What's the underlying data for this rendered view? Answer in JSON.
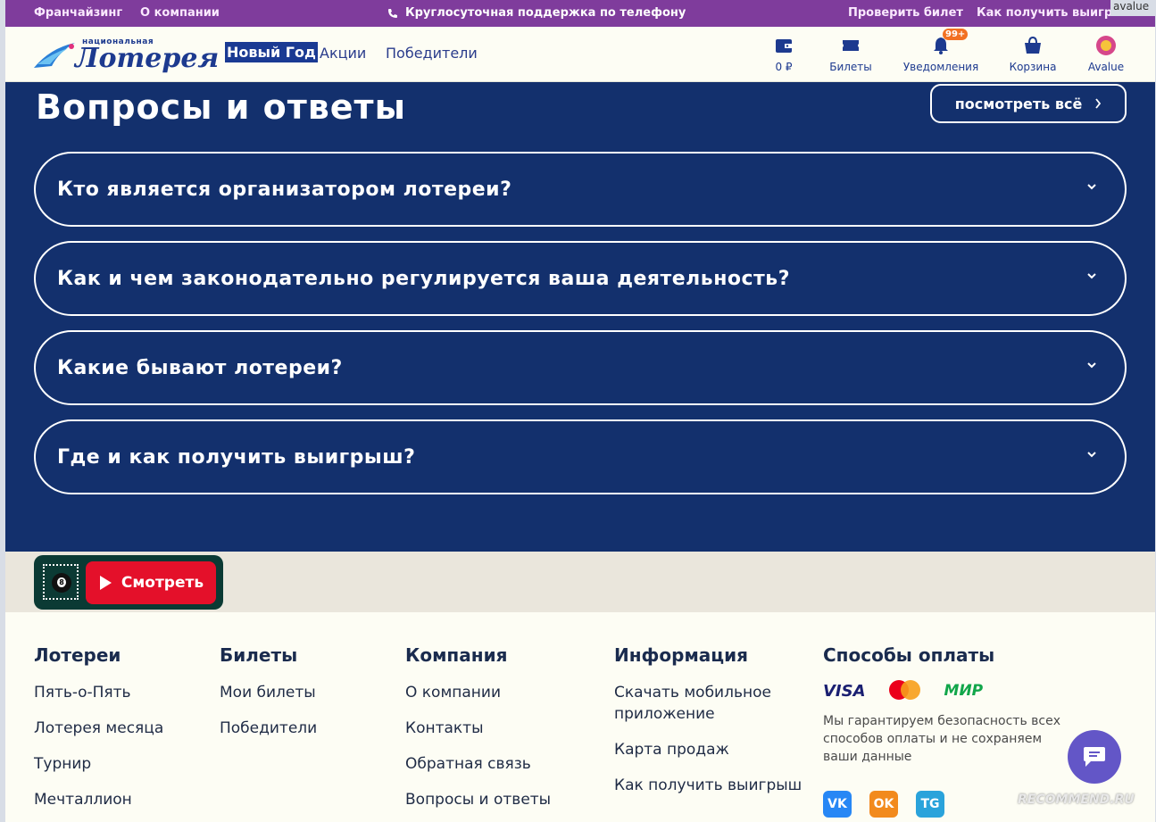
{
  "topbar": {
    "franchise": "Франчайзинг",
    "about": "О компании",
    "support": "Круглосуточная поддержка по телефону",
    "check_ticket": "Проверить билет",
    "how_to_win": "Как получить выигрыш"
  },
  "header": {
    "logo_small": "национальная",
    "logo_big": "Лотерея",
    "nav": [
      "Новый Год",
      "Акции",
      "Победители"
    ],
    "balance": "0 ₽",
    "tickets": "Билеты",
    "notifications": "Уведомления",
    "notifications_badge": "99+",
    "cart": "Корзина",
    "user": "Avalue"
  },
  "faq": {
    "title": "Вопросы и ответы",
    "view_all": "посмотреть всё",
    "questions": [
      "Кто является организатором лотереи?",
      "Как и чем законодательно регулируется ваша деятельность?",
      "Какие бывают лотереи?",
      "Где и как получить выигрыш?"
    ]
  },
  "watch": {
    "label": "Смотреть"
  },
  "footer": {
    "lotteries": {
      "title": "Лотереи",
      "items": [
        "Пять-о-Пять",
        "Лотерея месяца",
        "Турнир",
        "Мечталлион"
      ]
    },
    "tickets": {
      "title": "Билеты",
      "items": [
        "Мои билеты",
        "Победители"
      ]
    },
    "company": {
      "title": "Компания",
      "items": [
        "О компании",
        "Контакты",
        "Обратная связь",
        "Вопросы и ответы"
      ]
    },
    "info": {
      "title": "Информация",
      "items": [
        "Скачать мобильное приложение",
        "Карта продаж",
        "Как получить выигрыш"
      ]
    },
    "payment": {
      "title": "Способы оплаты",
      "visa": "VISA",
      "mir": "МИР",
      "note": "Мы гарантируем безопасность всех способов оплаты и не сохраняем ваши данные"
    },
    "socials": [
      "VK",
      "OK",
      "TG"
    ]
  },
  "watermarks": {
    "top_right": "avalue",
    "bottom_right": "RECOMMEND.RU"
  },
  "colors": {
    "purple_bar": "#7f3c9c",
    "navy": "#13306d",
    "red": "#e4102a",
    "bg": "#fdfdf4"
  }
}
